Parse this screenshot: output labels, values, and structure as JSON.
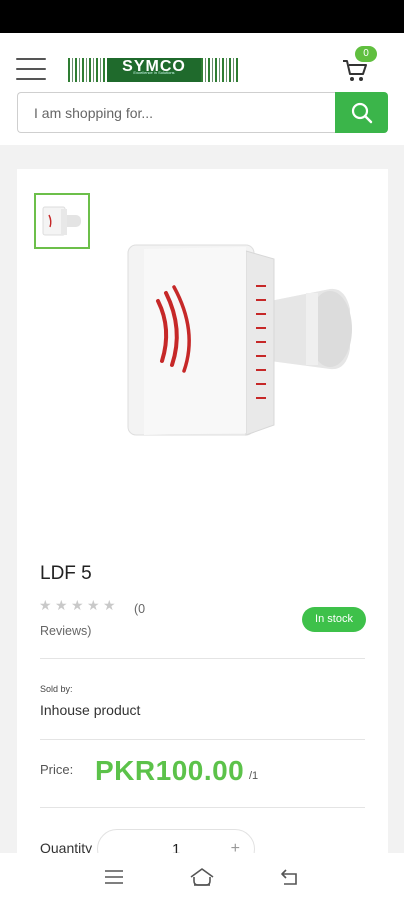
{
  "header": {
    "logo_text": "SYMCO",
    "logo_tagline": "Excellence in Solutions",
    "cart_count": "0"
  },
  "search": {
    "placeholder": "I am shopping for..."
  },
  "product": {
    "title": "LDF 5",
    "rating_stars": 0,
    "reviews_count": "(0",
    "reviews_label": "Reviews)",
    "stock": "In stock",
    "sold_by_label": "Sold by:",
    "sold_by_value": "Inhouse product",
    "price_label": "Price:",
    "price": "PKR100.00",
    "price_unit": "/1",
    "quantity_label": "Quantity",
    "quantity": "1",
    "plus": "+"
  },
  "colors": {
    "accent": "#3bb54a",
    "price": "#5cc24a",
    "brand": "#1f6a2c"
  },
  "icons": [
    "menu-icon",
    "cart-icon",
    "search-icon",
    "nav-menu-icon",
    "nav-home-icon",
    "nav-back-icon"
  ]
}
